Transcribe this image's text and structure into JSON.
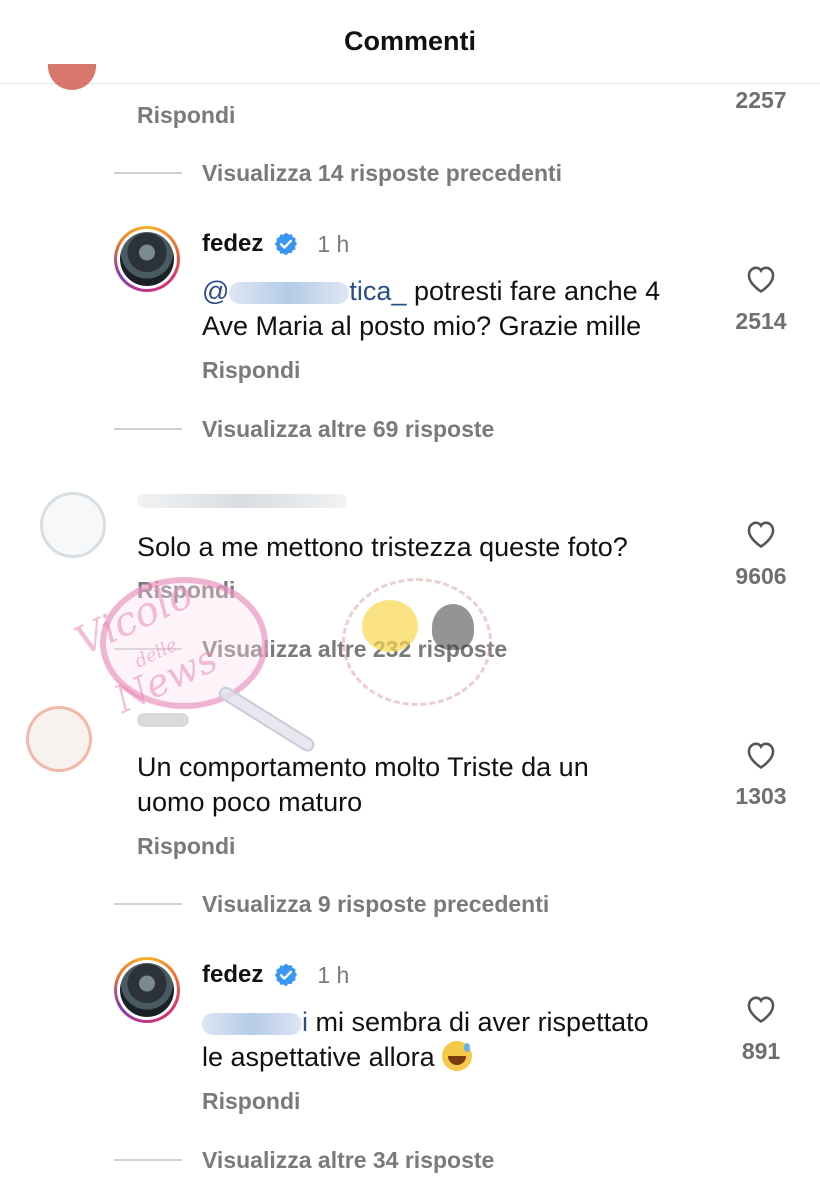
{
  "header": {
    "title": "Commenti"
  },
  "top_partial": {
    "reply": "Rispondi",
    "likes": "2257"
  },
  "thread1": {
    "link": "Visualizza 14 risposte precedenti"
  },
  "reply1": {
    "username": "fedez",
    "time": "1 h",
    "mention_visible": "@",
    "mention_tail": "tica_",
    "text_line1": " potresti fare anche 4",
    "text_line2": "Ave Maria al posto mio? Grazie mille",
    "reply": "Rispondi",
    "likes": "2514"
  },
  "thread2": {
    "link": "Visualizza altre 69 risposte"
  },
  "comment2": {
    "text": "Solo a me mettono tristezza queste foto?",
    "reply": "Rispondi",
    "likes": "9606"
  },
  "thread3": {
    "link": "Visualizza altre 232 risposte"
  },
  "comment3": {
    "text_line1": "Un comportamento molto Triste da un",
    "text_line2": "uomo poco maturo",
    "reply": "Rispondi",
    "likes": "1303"
  },
  "thread4": {
    "link": "Visualizza 9 risposte precedenti"
  },
  "reply2": {
    "username": "fedez",
    "time": "1 h",
    "mention_tail": "i",
    "text_line1": " mi sembra di aver rispettato",
    "text_line2": "le aspettative allora",
    "reply": "Rispondi",
    "likes": "891"
  },
  "thread5": {
    "link": "Visualizza altre 34 risposte"
  },
  "watermark": {
    "line1": "Vicolo",
    "line2": "delle",
    "line3": "News"
  },
  "colors": {
    "verified": "#3897f0",
    "secondary_text": "#7a7a7a",
    "divider": "#d0d0d0"
  }
}
